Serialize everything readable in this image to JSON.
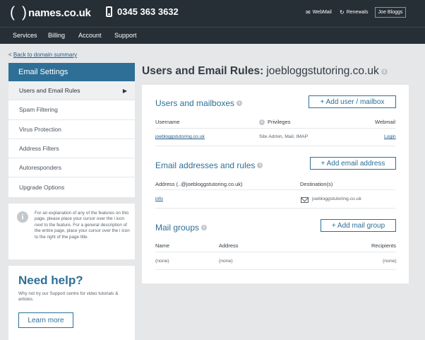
{
  "header": {
    "logo_paren_open": "(",
    "logo_paren_close": ")",
    "logo_text": "names.co.uk",
    "phone": "0345 363 3632",
    "webmail": "WebMail",
    "renewals": "Renewals",
    "user": "Joe Bloggs"
  },
  "nav": [
    "Services",
    "Billing",
    "Account",
    "Support"
  ],
  "back_link": {
    "prefix": "<",
    "label": "Back to domain summary"
  },
  "sidebar": {
    "title": "Email Settings",
    "items": [
      {
        "label": "Users and Email Rules",
        "active": true,
        "arrow": "▶"
      },
      {
        "label": "Spam Filtering"
      },
      {
        "label": "Virus Protection"
      },
      {
        "label": "Address Filters"
      },
      {
        "label": "Autoresponders"
      },
      {
        "label": "Upgrade Options"
      }
    ]
  },
  "info": {
    "icon": "i",
    "text": "For an explanation of any of the features on this page, please place your cursor over the i icon next to the feature. For a general description of the entire page, place your cursor over the i icon to the right of the page title."
  },
  "help": {
    "title": "Need help?",
    "text": "Why not try our Support centre for video tutorials & articles.",
    "button": "Learn more"
  },
  "page": {
    "title": "Users and Email Rules:",
    "domain": "joebloggstutoring.co.uk"
  },
  "users_section": {
    "title": "Users and mailboxes",
    "add_button": "+ Add user / mailbox",
    "columns": {
      "username": "Username",
      "privileges": "Privileges",
      "webmail": "Webmail"
    },
    "rows": [
      {
        "username": "joebloggstutoring.co.uk",
        "privileges": "Site Admin, Mail, IMAP",
        "webmail": "Login"
      }
    ]
  },
  "addresses_section": {
    "title": "Email addresses and rules",
    "add_button": "+ Add email address",
    "columns": {
      "address": "Address (..@joebloggstutoring.co.uk)",
      "destination": "Destination(s)"
    },
    "rows": [
      {
        "address": "info",
        "destination": "joebloggstutoring.co.uk"
      }
    ]
  },
  "groups_section": {
    "title": "Mail groups",
    "add_button": "+ Add mail group",
    "columns": {
      "name": "Name",
      "address": "Address",
      "recipients": "Recipients"
    },
    "rows": [
      {
        "name": "(none)",
        "address": "(none)",
        "recipients": "(none)"
      }
    ]
  },
  "colors": {
    "header_bg": "#262e36",
    "accent": "#2e6f97",
    "link": "#1f5a8c",
    "page_bg": "#e6e7e9"
  }
}
